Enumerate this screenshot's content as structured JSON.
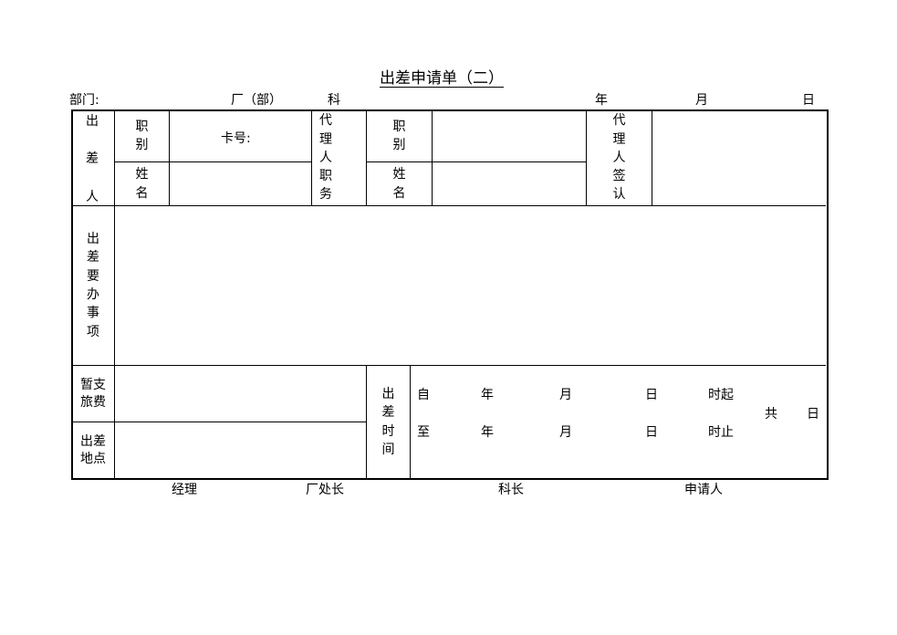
{
  "title": "出差申请单（二）",
  "header": {
    "dept_label": "部门:",
    "factory_label": "厂（部）",
    "section_label": "科",
    "year_label": "年",
    "month_label": "月",
    "day_label": "日"
  },
  "table": {
    "traveler_label": [
      "出",
      "差",
      "人"
    ],
    "position_label": [
      "职",
      "别"
    ],
    "name_label": [
      "姓",
      "名"
    ],
    "card_no_label": "卡号:",
    "card_no_value": "",
    "traveler_position_value": "",
    "traveler_name_value": "",
    "agent_position_label": [
      "代",
      "理",
      "人",
      "职",
      "务"
    ],
    "agent_job_label": [
      "职",
      "别"
    ],
    "agent_name_label": [
      "姓",
      "名"
    ],
    "agent_job_value": "",
    "agent_name_value": "",
    "agent_sign_label": [
      "代",
      "理",
      "人",
      "签",
      "认"
    ],
    "agent_sign_value": "",
    "matters_label": [
      "出",
      "差",
      "要",
      "办",
      "事",
      "项"
    ],
    "matters_value": "",
    "advance_label": [
      "暂支",
      "旅费"
    ],
    "advance_value": "",
    "place_label": [
      "出差",
      "地点"
    ],
    "place_value": "",
    "time_label": [
      "出",
      "差",
      "时",
      "间"
    ],
    "from_row": {
      "prefix": "自",
      "year": "年",
      "month": "月",
      "day": "日",
      "suffix": "时起"
    },
    "to_row": {
      "prefix": "至",
      "year": "年",
      "month": "月",
      "day": "日",
      "suffix": "时止"
    },
    "total_label": "共",
    "total_unit": "日"
  },
  "footer": {
    "manager": "经理",
    "factory_head": "厂处长",
    "section_head": "科长",
    "applicant": "申请人"
  }
}
